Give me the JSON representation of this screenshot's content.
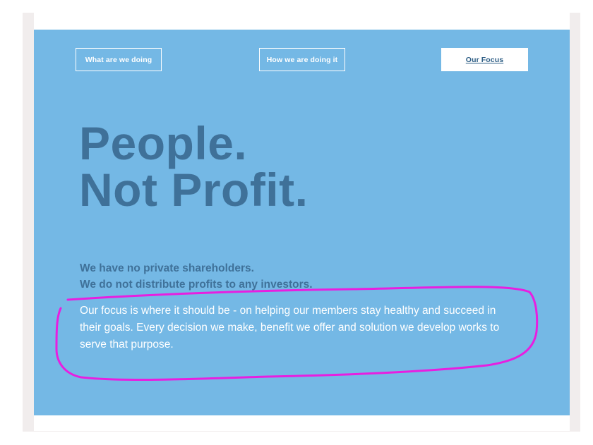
{
  "nav": {
    "items": [
      {
        "label": "What are we doing"
      },
      {
        "label": "How we are doing it"
      },
      {
        "label": "Our Focus",
        "active": true
      }
    ]
  },
  "hero": {
    "headline_line1": "People.",
    "headline_line2": "Not Profit.",
    "sub_line1": "We have no private shareholders.",
    "sub_line2": "We do not distribute profits to any investors.",
    "body": "Our focus is where it should be - on helping our members stay healthy and succeed in their goals. Every decision we make, benefit we offer and solution we develop works to serve that purpose."
  },
  "colors": {
    "panel_bg": "#74b8e5",
    "headline": "#3f7199",
    "body_text": "#ffffff",
    "annotation": "#e81ee0"
  }
}
